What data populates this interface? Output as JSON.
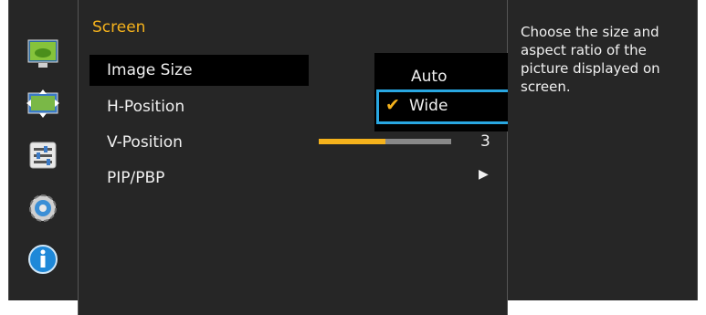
{
  "menu": {
    "title": "Screen",
    "items": [
      "Image Size",
      "H-Position",
      "V-Position",
      "PIP/PBP"
    ]
  },
  "submenu": {
    "options": [
      "Auto",
      "Wide"
    ],
    "selected": "Wide"
  },
  "slider": {
    "value_label": "3",
    "fill_fraction": 0.5
  },
  "help": {
    "text": "Choose the size and aspect ratio of the picture displayed on screen."
  },
  "icons": [
    "picture-icon",
    "screen-icon",
    "settings-icon",
    "system-gear-icon",
    "information-icon"
  ],
  "colors": {
    "accent": "#f5b21c",
    "highlight": "#29a7e1",
    "panel": "#262626"
  }
}
